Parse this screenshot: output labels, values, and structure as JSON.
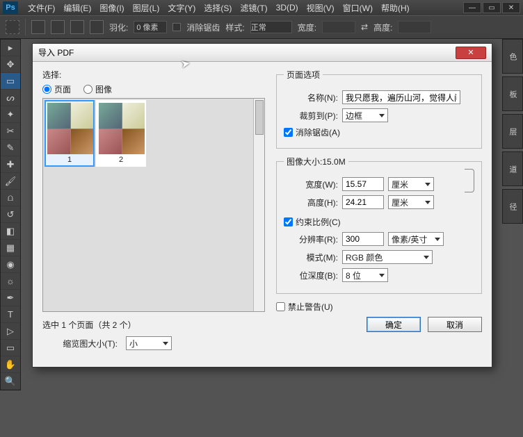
{
  "app": {
    "logo": "Ps"
  },
  "menu": [
    "文件(F)",
    "编辑(E)",
    "图像(I)",
    "图层(L)",
    "文字(Y)",
    "选择(S)",
    "滤镜(T)",
    "3D(D)",
    "视图(V)",
    "窗口(W)",
    "帮助(H)"
  ],
  "optionbar": {
    "feather_label": "羽化:",
    "feather_value": "0 像素",
    "antialias": "消除锯齿",
    "style_label": "样式:",
    "style_value": "正常",
    "width_label": "宽度:",
    "height_label": "高度:"
  },
  "right_tabs": [
    "色",
    "板",
    "层",
    "道",
    "径"
  ],
  "dialog": {
    "title": "导入 PDF",
    "select_label": "选择:",
    "radio_page": "页面",
    "radio_image": "图像",
    "thumbs": [
      {
        "num": "1"
      },
      {
        "num": "2"
      }
    ],
    "status": "选中 1 个页面（共 2 个）",
    "thumbsize_label": "缩览图大小(T):",
    "thumbsize_value": "小",
    "page_options": {
      "legend": "页面选项",
      "name_label": "名称(N):",
      "name_value": "我只愿我，遍历山河，觉得人间值",
      "crop_label": "裁剪到(P):",
      "crop_value": "边框",
      "antialias": "消除锯齿(A)"
    },
    "image_size": {
      "legend": "图像大小:15.0M",
      "width_label": "宽度(W):",
      "width_value": "15.57",
      "width_unit": "厘米",
      "height_label": "高度(H):",
      "height_value": "24.21",
      "height_unit": "厘米",
      "constrain": "约束比例(C)",
      "res_label": "分辨率(R):",
      "res_value": "300",
      "res_unit": "像素/英寸",
      "mode_label": "模式(M):",
      "mode_value": "RGB 颜色",
      "depth_label": "位深度(B):",
      "depth_value": "8 位"
    },
    "suppress": "禁止警告(U)",
    "ok": "确定",
    "cancel": "取消"
  }
}
